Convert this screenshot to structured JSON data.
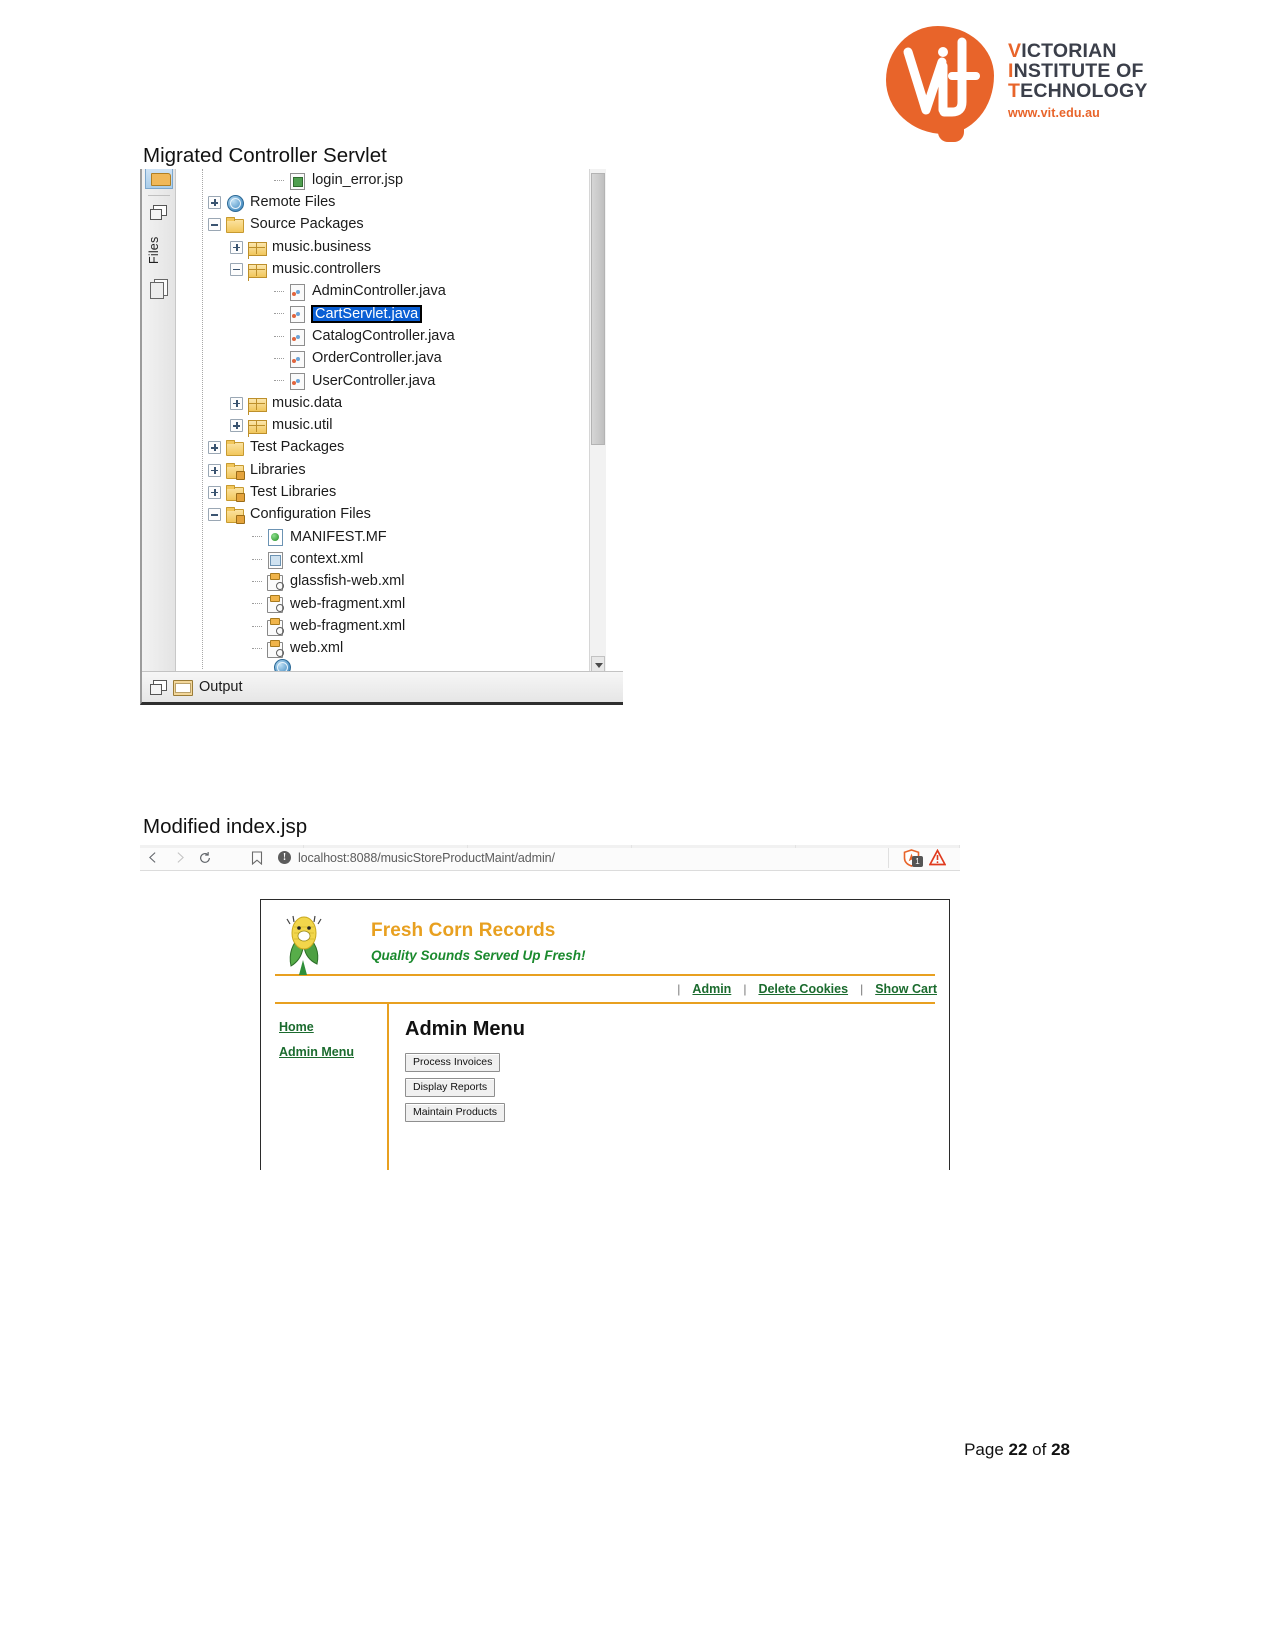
{
  "logo": {
    "line1_initial": "V",
    "line1_rest": "ICTORIAN",
    "line2_initial": "I",
    "line2_rest": "NSTITUTE OF",
    "line3_initial": "T",
    "line3_rest": "ECHNOLOGY",
    "url": "www.vit.edu.au",
    "brand_color": "#E8642A"
  },
  "captions": {
    "section1": "Migrated Controller Servlet",
    "section2": "Modified index.jsp"
  },
  "netbeans": {
    "sidebar": {
      "files_tab_label": "Files"
    },
    "output_label": "Output",
    "selected_node": "CartServlet.java",
    "tree": [
      {
        "label": "login_error.jsp",
        "indent": 4,
        "icon": "jsp-file-icon",
        "toggle": "none",
        "lead": true
      },
      {
        "label": "Remote Files",
        "indent": 1,
        "icon": "globe-icon",
        "toggle": "plus"
      },
      {
        "label": "Source Packages",
        "indent": 1,
        "icon": "folder-icon",
        "toggle": "minus"
      },
      {
        "label": "music.business",
        "indent": 2,
        "icon": "package-icon",
        "toggle": "plus"
      },
      {
        "label": "music.controllers",
        "indent": 2,
        "icon": "package-icon",
        "toggle": "minus"
      },
      {
        "label": "AdminController.java",
        "indent": 4,
        "icon": "java-class-icon",
        "toggle": "none",
        "lead": true
      },
      {
        "label": "CartServlet.java",
        "indent": 4,
        "icon": "java-class-icon",
        "toggle": "none",
        "lead": true,
        "selected": true
      },
      {
        "label": "CatalogController.java",
        "indent": 4,
        "icon": "java-class-icon",
        "toggle": "none",
        "lead": true
      },
      {
        "label": "OrderController.java",
        "indent": 4,
        "icon": "java-class-icon",
        "toggle": "none",
        "lead": true
      },
      {
        "label": "UserController.java",
        "indent": 4,
        "icon": "java-class-icon",
        "toggle": "none",
        "lead": true
      },
      {
        "label": "music.data",
        "indent": 2,
        "icon": "package-icon",
        "toggle": "plus"
      },
      {
        "label": "music.util",
        "indent": 2,
        "icon": "package-icon",
        "toggle": "plus"
      },
      {
        "label": "Test Packages",
        "indent": 1,
        "icon": "folder-icon",
        "toggle": "plus"
      },
      {
        "label": "Libraries",
        "indent": 1,
        "icon": "folder-icon",
        "toggle": "plus"
      },
      {
        "label": "Test Libraries",
        "indent": 1,
        "icon": "folder-icon",
        "toggle": "plus"
      },
      {
        "label": "Configuration Files",
        "indent": 1,
        "icon": "folder-icon",
        "toggle": "minus"
      },
      {
        "label": "MANIFEST.MF",
        "indent": 3,
        "icon": "manifest-icon",
        "toggle": "none",
        "lead": true
      },
      {
        "label": "context.xml",
        "indent": 3,
        "icon": "context-xml-icon",
        "toggle": "none",
        "lead": true
      },
      {
        "label": "glassfish-web.xml",
        "indent": 3,
        "icon": "xml-file-icon",
        "toggle": "none",
        "lead": true
      },
      {
        "label": "web-fragment.xml",
        "indent": 3,
        "icon": "xml-file-icon",
        "toggle": "none",
        "lead": true
      },
      {
        "label": "web-fragment.xml",
        "indent": 3,
        "icon": "xml-file-icon",
        "toggle": "none",
        "lead": true
      },
      {
        "label": "web.xml",
        "indent": 3,
        "icon": "xml-file-icon",
        "toggle": "none",
        "lead": true
      }
    ]
  },
  "browser": {
    "url": "localhost:8088/musicStoreProductMaint/admin/",
    "back_icon": "back-arrow-icon",
    "forward_icon": "forward-arrow-icon",
    "reload_icon": "reload-icon",
    "bookmark_icon": "bookmark-icon",
    "info_icon": "site-info-icon",
    "shield_icon": "adblock-shield-icon",
    "shield_badge": "1",
    "warning_icon": "warning-triangle-icon"
  },
  "site": {
    "title": "Fresh Corn Records",
    "tagline": "Quality Sounds Served Up Fresh!",
    "logo_icon": "corn-mascot-icon",
    "title_color": "#E8A020",
    "tagline_color": "#1b8a2e",
    "nav": [
      {
        "label": "Admin"
      },
      {
        "label": "Delete Cookies"
      },
      {
        "label": "Show Cart"
      }
    ],
    "nav_separator": "|",
    "aside": [
      {
        "label": "Home"
      },
      {
        "label": "Admin Menu"
      }
    ],
    "heading": "Admin Menu",
    "buttons": [
      {
        "label": "Process Invoices"
      },
      {
        "label": "Display Reports"
      },
      {
        "label": "Maintain Products"
      }
    ]
  },
  "footer": {
    "prefix": "Page ",
    "current": "22",
    "middle": " of ",
    "total": "28"
  }
}
